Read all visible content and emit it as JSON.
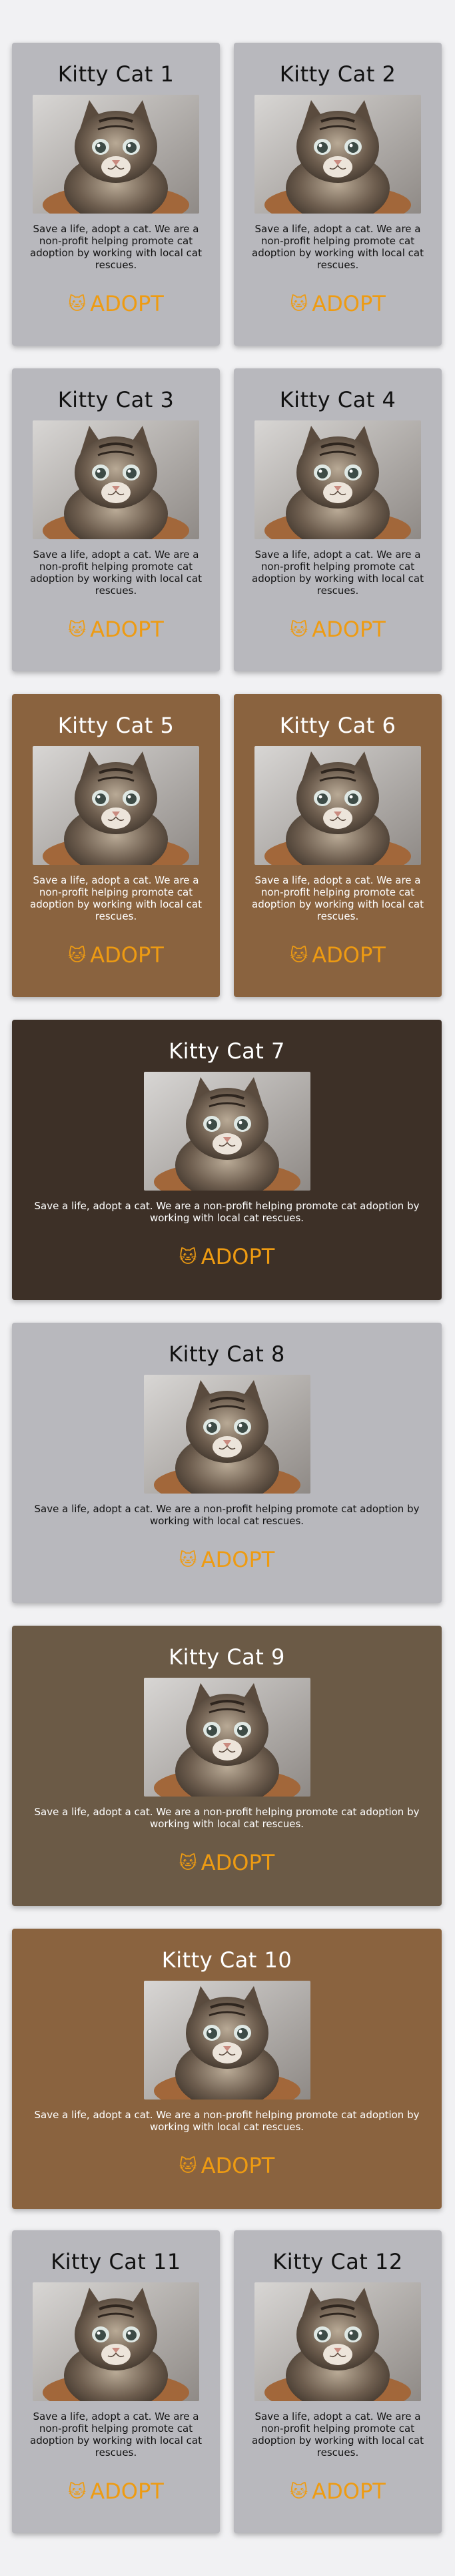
{
  "cards": [
    {
      "title": "Kitty Cat 1",
      "desc": "Save a life, adopt a cat. We are a non-profit helping promote cat adoption by working with local cat rescues.",
      "adopt": "ADOPT",
      "theme": "light"
    },
    {
      "title": "Kitty Cat 2",
      "desc": "Save a life, adopt a cat. We are a non-profit helping promote cat adoption by working with local cat rescues.",
      "adopt": "ADOPT",
      "theme": "light"
    },
    {
      "title": "Kitty Cat 3",
      "desc": "Save a life, adopt a cat. We are a non-profit helping promote cat adoption by working with local cat rescues.",
      "adopt": "ADOPT",
      "theme": "light"
    },
    {
      "title": "Kitty Cat 4",
      "desc": "Save a life, adopt a cat. We are a non-profit helping promote cat adoption by working with local cat rescues.",
      "adopt": "ADOPT",
      "theme": "light"
    },
    {
      "title": "Kitty Cat 5",
      "desc": "Save a life, adopt a cat. We are a non-profit helping promote cat adoption by working with local cat rescues.",
      "adopt": "ADOPT",
      "theme": "brown"
    },
    {
      "title": "Kitty Cat 6",
      "desc": "Save a life, adopt a cat. We are a non-profit helping promote cat adoption by working with local cat rescues.",
      "adopt": "ADOPT",
      "theme": "brown"
    },
    {
      "title": "Kitty Cat 7",
      "desc": "Save a life, adopt a cat. We are a non-profit helping promote cat adoption by working with local cat rescues.",
      "adopt": "ADOPT",
      "theme": "dark"
    },
    {
      "title": "Kitty Cat 8",
      "desc": "Save a life, adopt a cat. We are a non-profit helping promote cat adoption by working with local cat rescues.",
      "adopt": "ADOPT",
      "theme": "light"
    },
    {
      "title": "Kitty Cat 9",
      "desc": "Save a life, adopt a cat. We are a non-profit helping promote cat adoption by working with local cat rescues.",
      "adopt": "ADOPT",
      "theme": "mid"
    },
    {
      "title": "Kitty Cat 10",
      "desc": "Save a life, adopt a cat. We are a non-profit helping promote cat adoption by working with local cat rescues.",
      "adopt": "ADOPT",
      "theme": "brown"
    },
    {
      "title": "Kitty Cat 11",
      "desc": "Save a life, adopt a cat. We are a non-profit helping promote cat adoption by working with local cat rescues.",
      "adopt": "ADOPT",
      "theme": "light"
    },
    {
      "title": "Kitty Cat 12",
      "desc": "Save a life, adopt a cat. We are a non-profit helping promote cat adoption by working with local cat rescues.",
      "adopt": "ADOPT",
      "theme": "light"
    }
  ],
  "colors": {
    "light": "#b8b8bd",
    "brown": "#8a633f",
    "dark": "#3d3027",
    "mid": "#6b5a46",
    "adopt": "#ee9b12"
  },
  "icons": {
    "adopt": "cat-face-icon",
    "photo": "kitten-photo"
  }
}
